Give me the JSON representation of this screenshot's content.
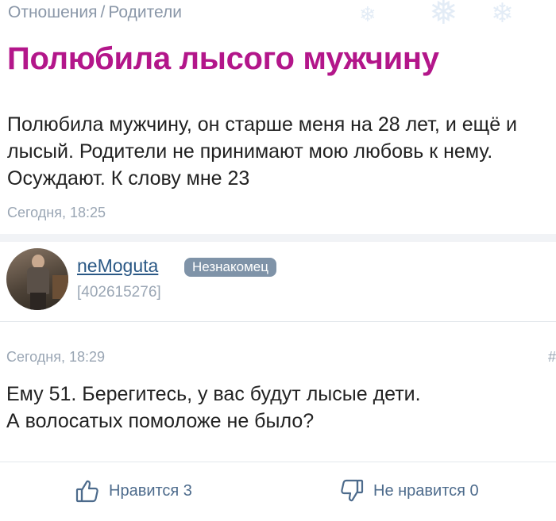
{
  "breadcrumb": {
    "items": [
      {
        "label": "Отношения"
      },
      {
        "label": "Родители"
      }
    ],
    "separator": "/"
  },
  "question": {
    "title": "Полюбила лысого мужчину",
    "body": "Полюбила мужчину, он старше меня на 28 лет, и ещё и лысый. Родители не принимают мою любовь к нему. Осуждают. К слову мне 23",
    "time": "Сегодня, 18:25"
  },
  "answer": {
    "author": {
      "name": "neMoguta",
      "badge": "Незнакомец",
      "id": "[402615276]"
    },
    "time": "Сегодня, 18:29",
    "anchor": "#",
    "body_line1": "Ему 51. Берегитесь, у вас будут лысые дети.",
    "body_line2": "А волосатых помоложе не было?",
    "likes_label": "Нравится 3",
    "dislikes_label": "Не нравится 0"
  },
  "colors": {
    "title": "#b3168a",
    "link": "#2a5885",
    "muted": "#9aa6b4",
    "badge": "#7f93a8",
    "action": "#4d6b8c"
  },
  "icons": {
    "like": "thumbs-up-icon",
    "dislike": "thumbs-down-icon",
    "decor": "snowflake-icon"
  }
}
